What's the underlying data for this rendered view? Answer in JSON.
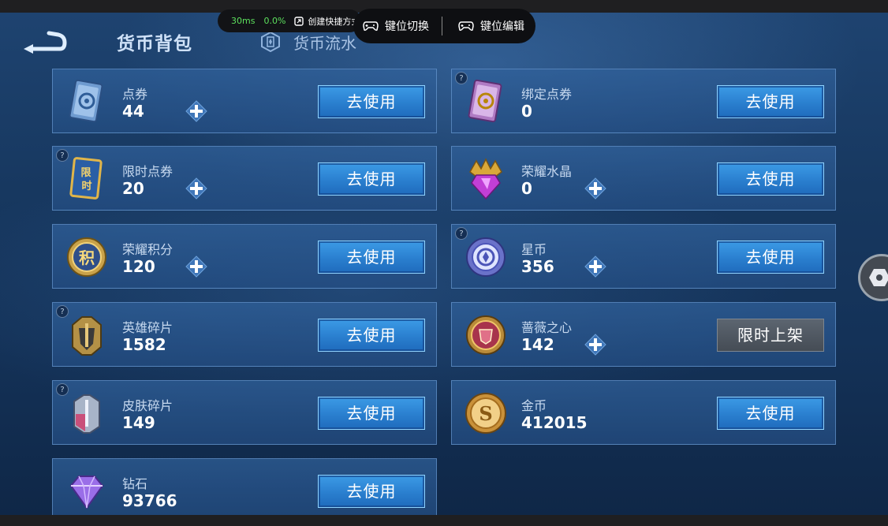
{
  "header": {
    "title": "货币背包",
    "tab_flow": "货币流水"
  },
  "overlay": {
    "latency": "30ms",
    "loss": "0.0%",
    "create_shortcut": "创建快捷方式",
    "key_switch": "键位切换",
    "key_edit": "键位编辑"
  },
  "use_label": "去使用",
  "cards": [
    {
      "name": "点券",
      "value": "44",
      "button": "去使用"
    },
    {
      "name": "绑定点券",
      "value": "0",
      "button": "去使用"
    },
    {
      "name": "限时点券",
      "value": "20",
      "button": "去使用"
    },
    {
      "name": "荣耀水晶",
      "value": "0",
      "button": "去使用"
    },
    {
      "name": "荣耀积分",
      "value": "120",
      "button": "去使用"
    },
    {
      "name": "星币",
      "value": "356",
      "button": "去使用"
    },
    {
      "name": "英雄碎片",
      "value": "1582",
      "button": "去使用"
    },
    {
      "name": "蔷薇之心",
      "value": "142",
      "button": "限时上架"
    },
    {
      "name": "皮肤碎片",
      "value": "149",
      "button": "去使用"
    },
    {
      "name": "金币",
      "value": "412015",
      "button": "去使用"
    },
    {
      "name": "钻石",
      "value": "93766",
      "button": "去使用"
    }
  ],
  "icon_labels": {
    "limited": "限时",
    "points": "积"
  },
  "colors": {
    "accent_blue": "#2a7fcf",
    "value_text": "#ffffff",
    "latency_green": "#5de05d"
  }
}
